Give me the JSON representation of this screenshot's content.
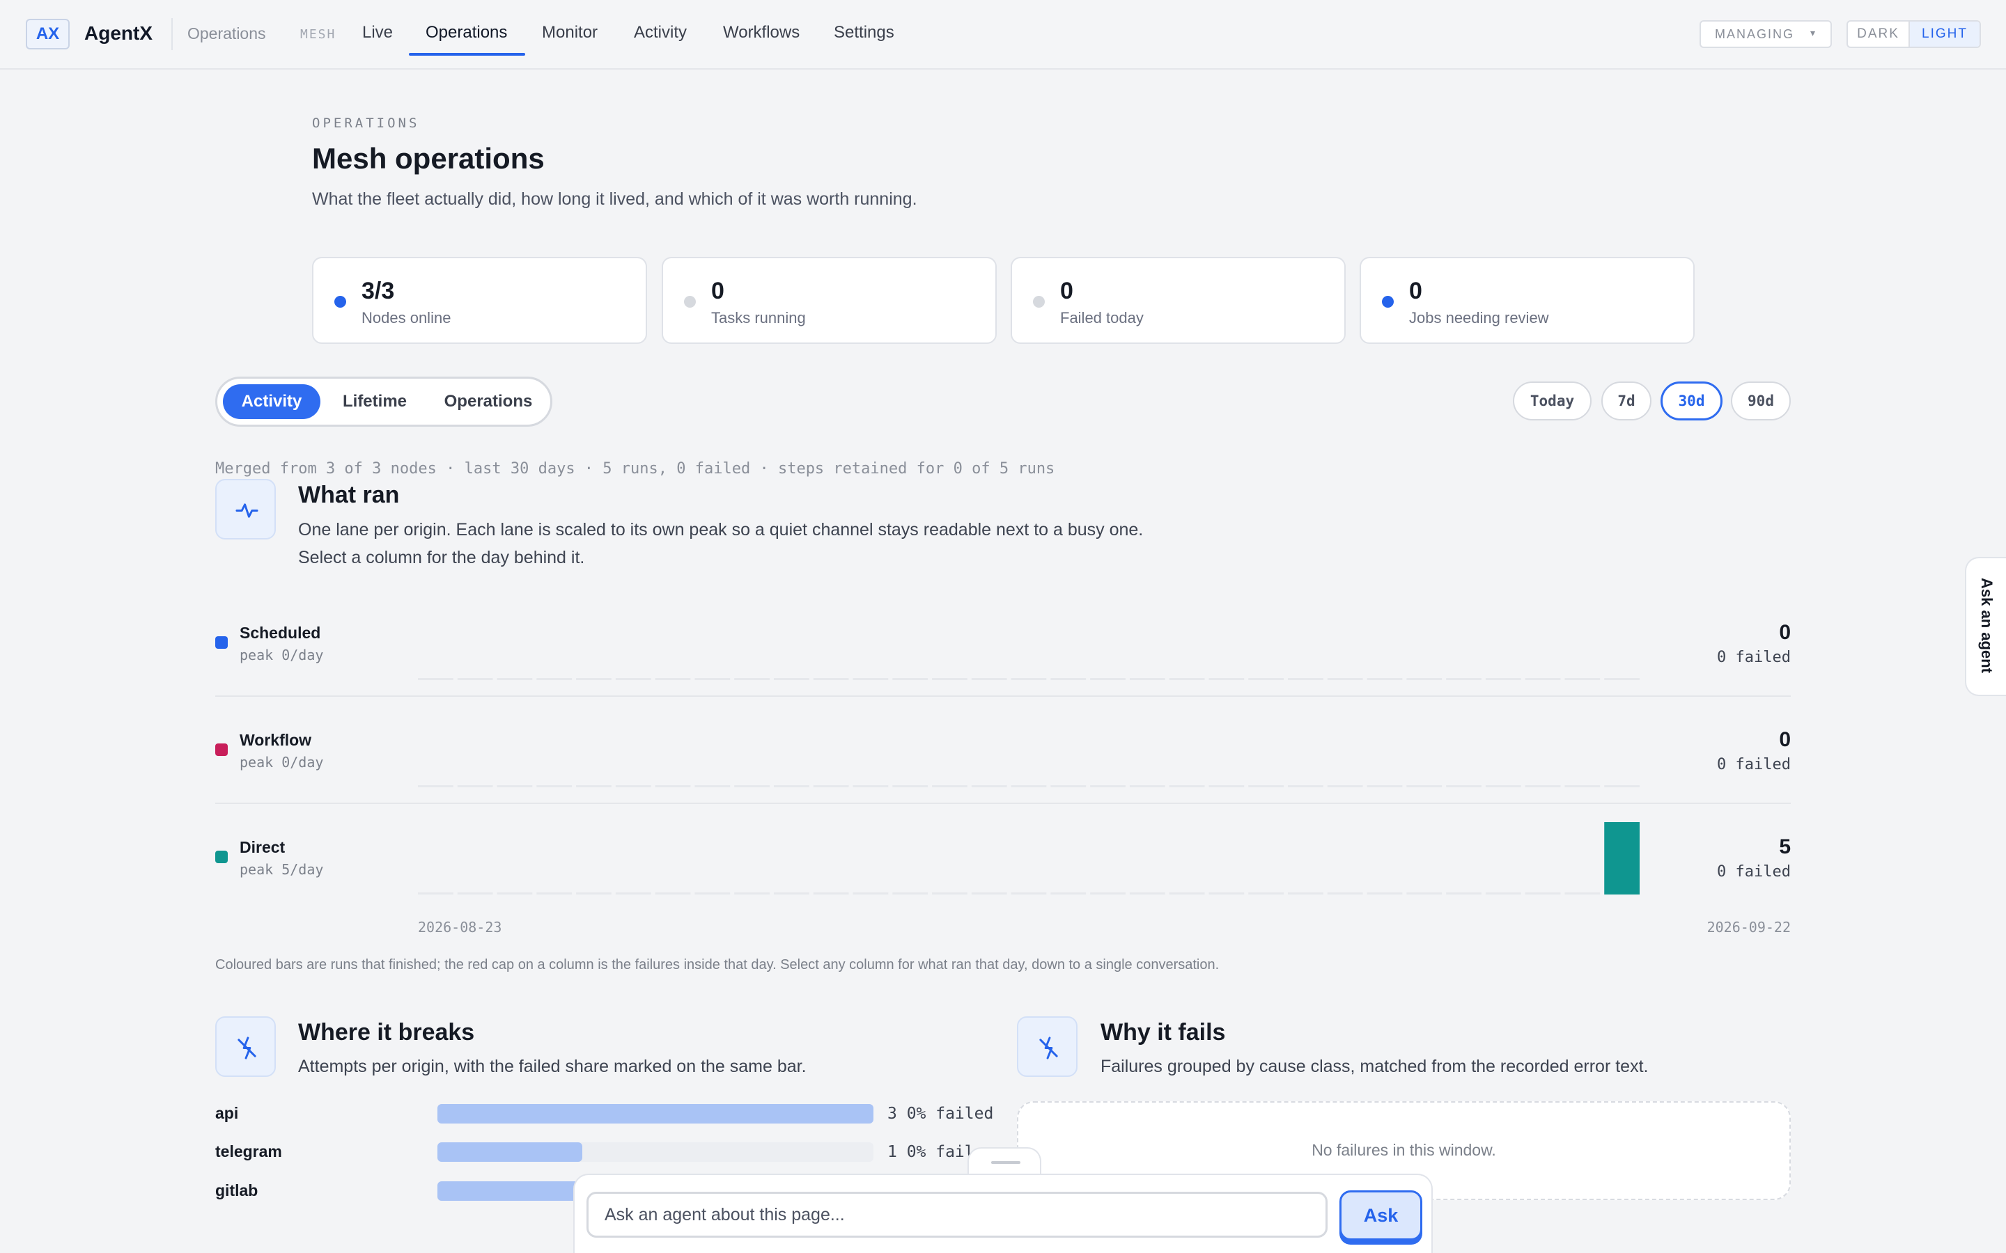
{
  "app": {
    "logo": "AX",
    "name": "AgentX",
    "crumb": "Operations",
    "mesh_tag": "MESH"
  },
  "nav": {
    "items": [
      {
        "label": "Live"
      },
      {
        "label": "Operations",
        "active": true
      },
      {
        "label": "Monitor"
      },
      {
        "label": "Activity"
      },
      {
        "label": "Workflows"
      },
      {
        "label": "Settings"
      }
    ],
    "managing_label": "MANAGING",
    "theme": {
      "dark": "DARK",
      "light": "LIGHT",
      "selected": "LIGHT"
    }
  },
  "header": {
    "eyebrow": "OPERATIONS",
    "title": "Mesh operations",
    "subtitle": "What the fleet actually did, how long it lived, and which of it was worth running."
  },
  "stats": [
    {
      "value": "3/3",
      "label": "Nodes online",
      "status": "active"
    },
    {
      "value": "0",
      "label": "Tasks running",
      "status": "idle"
    },
    {
      "value": "0",
      "label": "Failed today",
      "status": "idle"
    },
    {
      "value": "0",
      "label": "Jobs needing review",
      "status": "active"
    }
  ],
  "tabs": [
    {
      "label": "Activity",
      "active": true
    },
    {
      "label": "Lifetime",
      "active": false
    },
    {
      "label": "Operations",
      "active": false
    }
  ],
  "ranges": [
    {
      "label": "Today",
      "active": false
    },
    {
      "label": "7d",
      "active": false
    },
    {
      "label": "30d",
      "active": true
    },
    {
      "label": "90d",
      "active": false
    }
  ],
  "merged_note": "Merged from 3 of 3 nodes · last 30 days · 5 runs, 0 failed · steps retained for 0 of 5 runs",
  "what_ran": {
    "icon": "pulse-icon",
    "title": "What ran",
    "desc1": "One lane per origin. Each lane is scaled to its own peak so a quiet channel stays readable next to a busy one.",
    "desc2": "Select a column for the day behind it."
  },
  "chart_data": {
    "type": "bar",
    "x_start": "2026-08-23",
    "x_end": "2026-09-22",
    "days": 31,
    "series": [
      {
        "name": "Scheduled",
        "peak": "peak 0/day",
        "total": "0",
        "failed": "0 failed",
        "color": "#2563eb",
        "values": [
          0,
          0,
          0,
          0,
          0,
          0,
          0,
          0,
          0,
          0,
          0,
          0,
          0,
          0,
          0,
          0,
          0,
          0,
          0,
          0,
          0,
          0,
          0,
          0,
          0,
          0,
          0,
          0,
          0,
          0,
          0
        ]
      },
      {
        "name": "Workflow",
        "peak": "peak 0/day",
        "total": "0",
        "failed": "0 failed",
        "color": "#c81e5a",
        "values": [
          0,
          0,
          0,
          0,
          0,
          0,
          0,
          0,
          0,
          0,
          0,
          0,
          0,
          0,
          0,
          0,
          0,
          0,
          0,
          0,
          0,
          0,
          0,
          0,
          0,
          0,
          0,
          0,
          0,
          0,
          0
        ]
      },
      {
        "name": "Direct",
        "peak": "peak 5/day",
        "total": "5",
        "failed": "0 failed",
        "color": "#0f9690",
        "values": [
          0,
          0,
          0,
          0,
          0,
          0,
          0,
          0,
          0,
          0,
          0,
          0,
          0,
          0,
          0,
          0,
          0,
          0,
          0,
          0,
          0,
          0,
          0,
          0,
          0,
          0,
          0,
          0,
          0,
          0,
          5
        ]
      }
    ],
    "note": "Coloured bars are runs that finished; the red cap on a column is the failures inside that day. Select any column for what ran that day, down to a single conversation."
  },
  "breaks": {
    "icon": "lightning-icon",
    "title": "Where it breaks",
    "desc": "Attempts per origin, with the failed share marked on the same bar.",
    "rows": [
      {
        "name": "api",
        "attempts": 3,
        "fraction": 1.0,
        "stat": "3 0% failed"
      },
      {
        "name": "telegram",
        "attempts": 1,
        "fraction": 0.333,
        "stat": "1 0% fail"
      },
      {
        "name": "gitlab",
        "attempts": 1,
        "fraction": 0.333,
        "stat": ""
      }
    ]
  },
  "fails": {
    "icon": "lightning-icon",
    "title": "Why it fails",
    "desc": "Failures grouped by cause class, matched from the recorded error text.",
    "empty": "No failures in this window."
  },
  "ask": {
    "placeholder": "Ask an agent about this page...",
    "button": "Ask",
    "side_tab": "Ask an agent"
  },
  "colors": {
    "accent": "#2563eb",
    "dot_active": "#2563eb",
    "dot_idle": "#d6d9de"
  }
}
